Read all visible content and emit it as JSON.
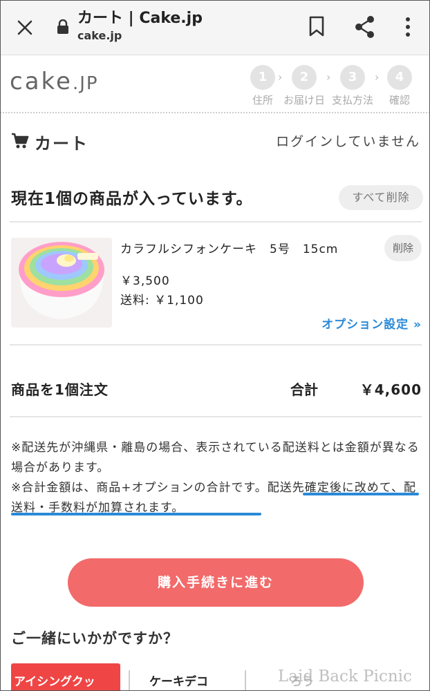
{
  "browser": {
    "title": "カート | Cake.jp",
    "url": "cake.jp"
  },
  "site": {
    "logo": "cake",
    "logo_suffix": ".JP",
    "steps": [
      {
        "num": "1",
        "label": "住所"
      },
      {
        "num": "2",
        "label": "お届け日"
      },
      {
        "num": "3",
        "label": "支払方法"
      },
      {
        "num": "4",
        "label": "確認"
      }
    ]
  },
  "cart": {
    "title": "カート",
    "login_status": "ログインしていません",
    "count_text": "現在1個の商品が入っています。",
    "delete_all": "すべて削除",
    "item": {
      "name": "カラフルシフォンケーキ　5号　15cm",
      "delete": "削除",
      "price": "￥3,500",
      "shipping": "送料: ￥1,100",
      "option_link": "オプション設定 »"
    },
    "order_summary": "商品を1個注文",
    "total_label": "合計",
    "total_value": "￥4,600"
  },
  "notice": {
    "line1": "※配送先が沖縄県・離島の場合、表示されている配送料とは金額が異なる場合があります。",
    "line2_plain": "※合計金額は、商品+オプションの合計です。",
    "line2_highlight": "配送先確定後に改めて、配送料・手数料が加算されます。"
  },
  "checkout_label": "購入手続きに進む",
  "suggest": {
    "title": "ご一緒にいかがですか？",
    "tabs": [
      "アイシングクッ",
      "ケーキデコ",
      "ろう"
    ]
  },
  "watermark": "Laid Back Picnic",
  "colors": {
    "accent": "#f26a6a",
    "link": "#2a8ad8",
    "tab_active": "#ef4545"
  }
}
